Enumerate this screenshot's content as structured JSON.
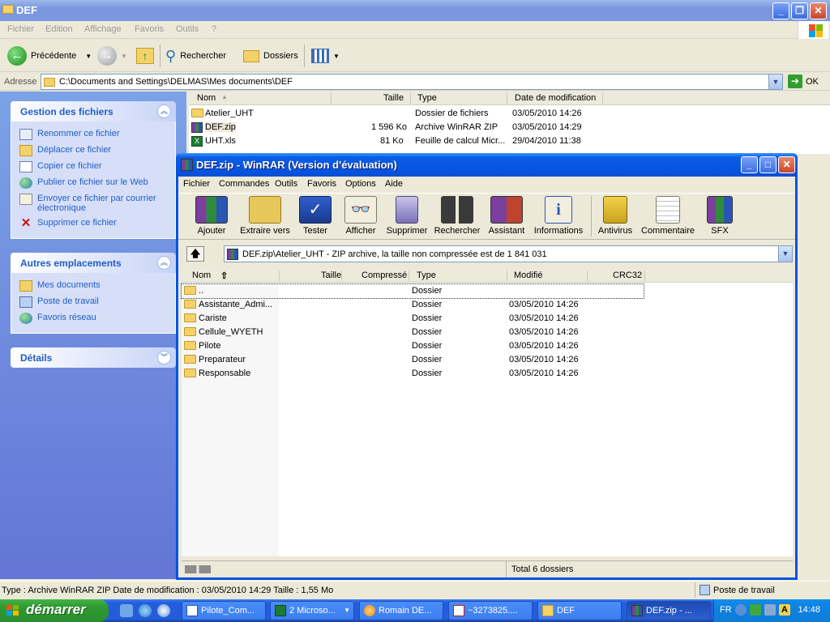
{
  "explorer": {
    "title": "DEF",
    "menu": [
      "Fichier",
      "Edition",
      "Affichage",
      "Favoris",
      "Outils",
      "?"
    ],
    "toolbar": {
      "back": "Précédente",
      "search": "Rechercher",
      "folders": "Dossiers"
    },
    "address_label": "Adresse",
    "address": "C:\\Documents and Settings\\DELMAS\\Mes documents\\DEF",
    "go": "OK",
    "taskpane": {
      "file_tasks": {
        "title": "Gestion des fichiers",
        "items": [
          "Renommer ce fichier",
          "Déplacer ce fichier",
          "Copier ce fichier",
          "Publier ce fichier sur le Web",
          "Envoyer ce fichier par courrier électronique",
          "Supprimer ce fichier"
        ]
      },
      "other_places": {
        "title": "Autres emplacements",
        "items": [
          "Mes documents",
          "Poste de travail",
          "Favoris réseau"
        ]
      },
      "details": {
        "title": "Détails"
      }
    },
    "columns": [
      "Nom",
      "Taille",
      "Type",
      "Date de modification"
    ],
    "files": [
      {
        "name": "Atelier_UHT",
        "size": "",
        "type": "Dossier de fichiers",
        "date": "03/05/2010 14:26"
      },
      {
        "name": "DEF.zip",
        "size": "1 596 Ko",
        "type": "Archive WinRAR ZIP",
        "date": "03/05/2010 14:29"
      },
      {
        "name": "UHT.xls",
        "size": "81 Ko",
        "type": "Feuille de calcul Micr...",
        "date": "29/04/2010 11:38"
      }
    ],
    "status_left": "Type : Archive WinRAR ZIP Date de modification : 03/05/2010 14:29 Taille : 1,55 Mo",
    "status_right": "Poste de travail"
  },
  "winrar": {
    "title": "DEF.zip - WinRAR (Version d'évaluation)",
    "menu": [
      "Fichier",
      "Commandes",
      "Outils",
      "Favoris",
      "Options",
      "Aide"
    ],
    "tools": [
      "Ajouter",
      "Extraire vers",
      "Tester",
      "Afficher",
      "Supprimer",
      "Rechercher",
      "Assistant",
      "Informations",
      "Antivirus",
      "Commentaire",
      "SFX"
    ],
    "path": "DEF.zip\\Atelier_UHT - ZIP archive, la taille non compressée est de 1 841 031",
    "columns": [
      "Nom",
      "Taille",
      "Compressé",
      "Type",
      "Modifié",
      "CRC32"
    ],
    "rows": [
      {
        "name": "..",
        "type": "Dossier",
        "modified": ""
      },
      {
        "name": "Assistante_Admi...",
        "type": "Dossier",
        "modified": "03/05/2010 14:26"
      },
      {
        "name": "Cariste",
        "type": "Dossier",
        "modified": "03/05/2010 14:26"
      },
      {
        "name": "Cellule_WYETH",
        "type": "Dossier",
        "modified": "03/05/2010 14:26"
      },
      {
        "name": "Pilote",
        "type": "Dossier",
        "modified": "03/05/2010 14:26"
      },
      {
        "name": "Preparateur",
        "type": "Dossier",
        "modified": "03/05/2010 14:26"
      },
      {
        "name": "Responsable",
        "type": "Dossier",
        "modified": "03/05/2010 14:26"
      }
    ],
    "status": "Total 6 dossiers"
  },
  "taskbar": {
    "start": "démarrer",
    "tasks": [
      "Pilote_Com...",
      "2 Microso...",
      "Romain DE...",
      "~3273825....",
      "DEF",
      "DEF.zip - ..."
    ],
    "lang": "FR",
    "clock": "14:48"
  },
  "colors": {
    "xp_blue": "#0054E3",
    "taskpane": "#6375D6",
    "link": "#215DC6",
    "start_green": "#2F9B33"
  }
}
